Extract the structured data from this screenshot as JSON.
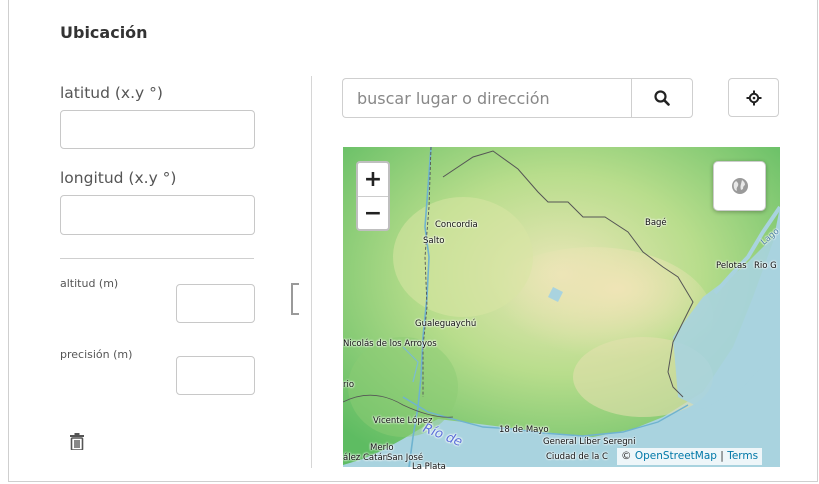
{
  "section": {
    "title": "Ubicación"
  },
  "fields": {
    "latitude_label": "latitud (x.y °)",
    "latitude_value": "",
    "longitude_label": "longitud (x.y °)",
    "longitude_value": "",
    "altitude_label": "altitud (m)",
    "altitude_value": "",
    "precision_label": "precisión (m)",
    "precision_value": ""
  },
  "search": {
    "placeholder": "buscar lugar o dirección"
  },
  "map": {
    "zoom_in": "+",
    "zoom_out": "−",
    "attribution_prefix": "©",
    "attribution_osm": "OpenStreetMap",
    "attribution_sep": "|",
    "attribution_terms": "Terms",
    "places": {
      "concordia": "Concordia",
      "salto": "Salto",
      "bage": "Bagé",
      "lagoa": "Lago",
      "pelotas": "Pelotas",
      "rio_grande": "Rio G",
      "gualeguaychu": "Gualeguaychú",
      "san_nicolas": "Nicolás de los Arroyos",
      "rosario": "rio",
      "vicente_lopez": "Vicente López",
      "merlo": "Merlo",
      "lez_catan": "ález Catán",
      "san_jose": "San José",
      "la_plata": "La Plata",
      "rio_de_la_plata": "Río de",
      "dieciocho_mayo": "18 de Mayo",
      "general_seregni": "General Líber Seregni",
      "ciudad_costa": "Ciudad de la C"
    }
  },
  "icons": {
    "search": "search-icon",
    "locate": "crosshair-icon",
    "layers": "globe-icon",
    "trash": "trash-icon"
  },
  "colors": {
    "sea": "#a9d3df",
    "land_green": "#6cc26a",
    "osm_link": "#0078a8"
  }
}
